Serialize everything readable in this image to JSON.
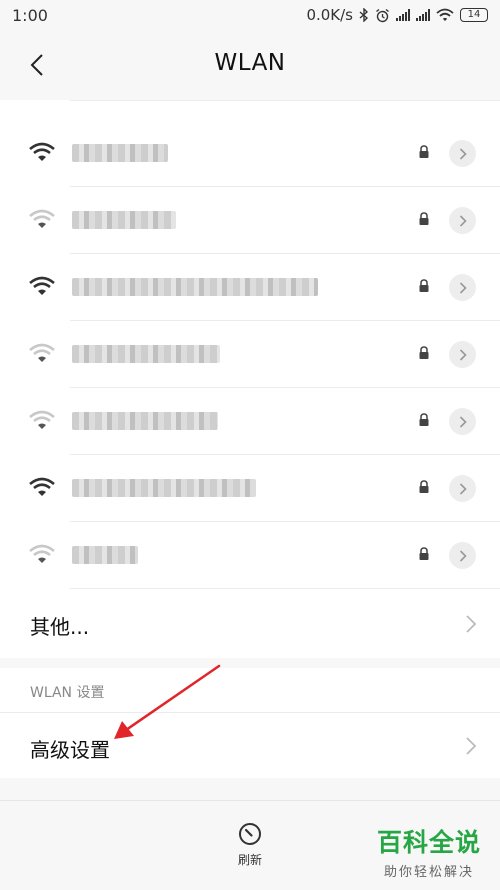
{
  "status_bar": {
    "time": "1:00",
    "net_speed": "0.0K/s",
    "battery": "14",
    "icons": [
      "bluetooth-icon",
      "alarm-icon",
      "signal-icon",
      "signal-icon",
      "wifi-icon",
      "battery-icon"
    ]
  },
  "header": {
    "title": "WLAN",
    "back_icon": "chevron-left-icon"
  },
  "networks": [
    {
      "name": "",
      "signal": "strong",
      "secured": true
    },
    {
      "name": "",
      "signal": "weak",
      "secured": true
    },
    {
      "name": "",
      "signal": "strong",
      "secured": true
    },
    {
      "name": "",
      "signal": "weak",
      "secured": true
    },
    {
      "name": "",
      "signal": "weak",
      "secured": true
    },
    {
      "name": "",
      "signal": "strong",
      "secured": true
    },
    {
      "name": "",
      "signal": "weak",
      "secured": true
    }
  ],
  "other_item": {
    "label": "其他..."
  },
  "wlan_settings": {
    "section_label": "WLAN 设置",
    "advanced_label": "高级设置"
  },
  "bottom_bar": {
    "refresh_label": "刷新"
  },
  "watermark": {
    "main": "百科全说",
    "sub": "助你轻松解决"
  },
  "colors": {
    "accent": "#27a645",
    "annotation_arrow": "#e0262b",
    "background": "#f7f7f7"
  }
}
